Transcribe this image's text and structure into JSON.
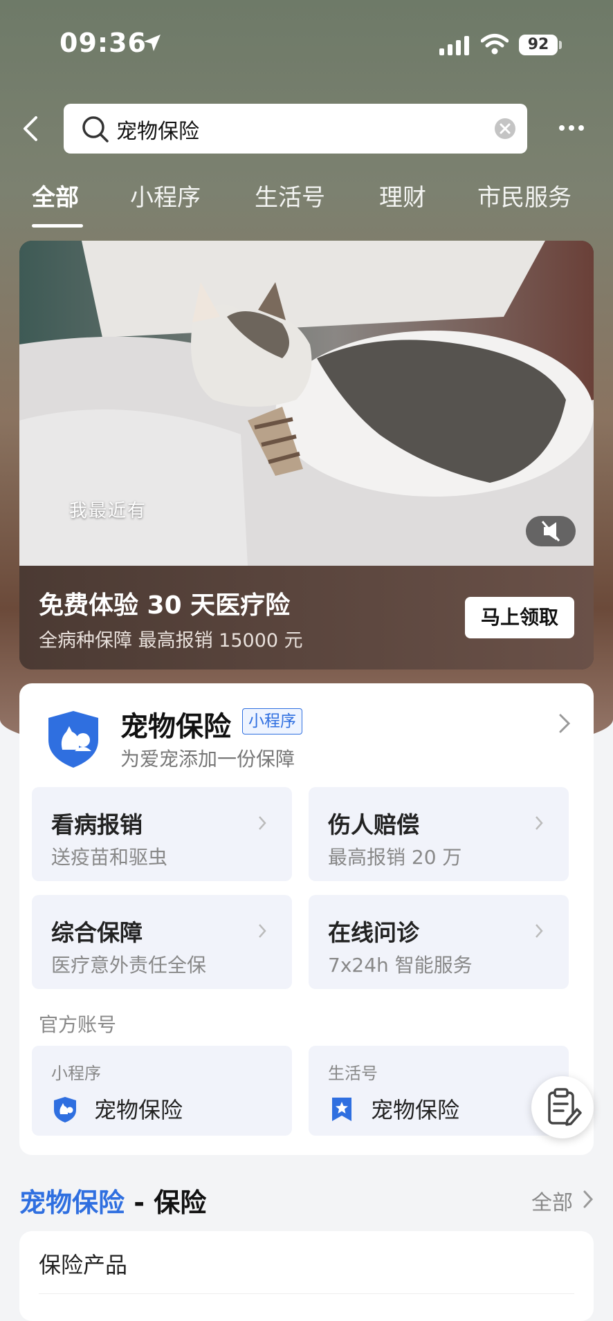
{
  "status_bar": {
    "time": "09:36",
    "battery": "92"
  },
  "search": {
    "query": "宠物保险"
  },
  "tabs": [
    {
      "label": "全部",
      "active": true
    },
    {
      "label": "小程序"
    },
    {
      "label": "生活号"
    },
    {
      "label": "理财"
    },
    {
      "label": "市民服务"
    }
  ],
  "promo": {
    "video_caption": "我最近有",
    "title": "免费体验 30 天医疗险",
    "subtitle": "全病种保障 最高报销 15000 元",
    "button": "马上领取"
  },
  "app_card": {
    "name": "宠物保险",
    "tag": "小程序",
    "description": "为爱宠添加一份保障",
    "features": [
      {
        "title": "看病报销",
        "subtitle": "送疫苗和驱虫"
      },
      {
        "title": "伤人赔偿",
        "subtitle": "最高报销 20 万"
      },
      {
        "title": "综合保障",
        "subtitle": "医疗意外责任全保"
      },
      {
        "title": "在线问诊",
        "subtitle": "7x24h 智能服务"
      }
    ],
    "official_label": "官方账号",
    "accounts": [
      {
        "type": "小程序",
        "name": "宠物保险"
      },
      {
        "type": "生活号",
        "name": "宠物保险"
      }
    ]
  },
  "section": {
    "title_highlight": "宠物保险",
    "title_rest": " - 保险",
    "more": "全部",
    "first_item": "保险产品"
  },
  "colors": {
    "accent": "#2f6fe0",
    "logo_blue": "#2f6fe0"
  }
}
